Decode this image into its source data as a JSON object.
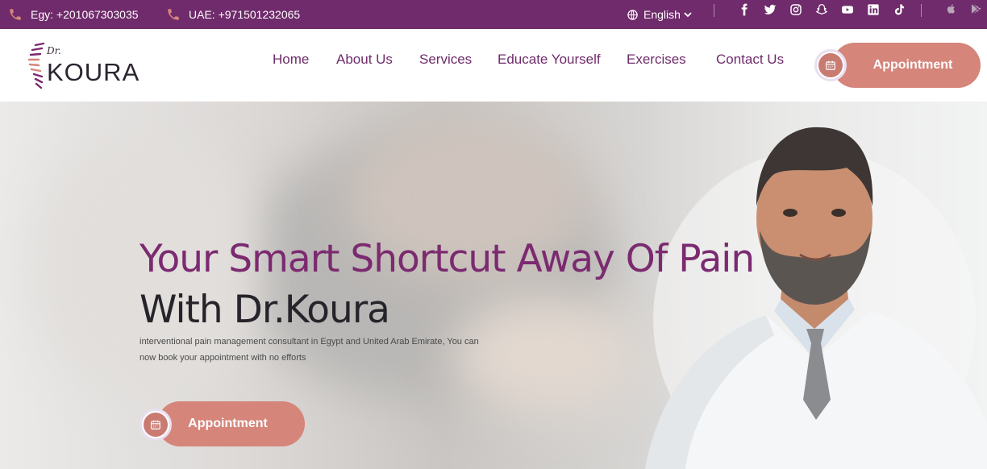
{
  "topbar": {
    "phone_egy": "Egy: +201067303035",
    "phone_uae": "UAE: +971501232065",
    "language": "English",
    "social_icons": [
      "facebook-icon",
      "twitter-icon",
      "instagram-icon",
      "snapchat-icon",
      "youtube-icon",
      "linkedin-icon",
      "tiktok-icon"
    ],
    "store_icons": [
      "apple-icon",
      "google-play-icon"
    ]
  },
  "logo": {
    "prefix": "Dr.",
    "name": "KOURA"
  },
  "nav": {
    "items": [
      "Home",
      "About Us",
      "Services",
      "Educate Yourself",
      "Exercises",
      "Contact Us"
    ],
    "appointment_label": "Appointment"
  },
  "hero": {
    "title_line1": "Your Smart Shortcut Away Of Pain",
    "title_line2": "With Dr.Koura",
    "subtitle": "interventional pain management consultant in Egypt and United Arab Emirate, You can now book your appointment with no efforts",
    "appointment_label": "Appointment"
  },
  "colors": {
    "brand_purple": "#6f2b6b",
    "accent_salmon": "#d5857a",
    "hero_title": "#7b2a70"
  }
}
